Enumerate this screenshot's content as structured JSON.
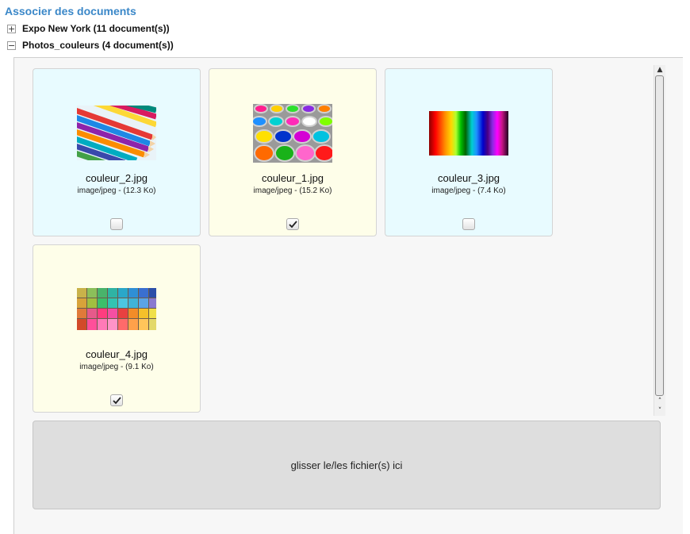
{
  "header": {
    "title": "Associer des documents"
  },
  "groups": [
    {
      "label": "Expo New York (11 document(s))",
      "toggle": "+",
      "expanded": false
    },
    {
      "label": "Photos_couleurs (4 document(s))",
      "toggle": "−",
      "expanded": true
    }
  ],
  "documents": [
    {
      "filename": "couleur_2.jpg",
      "meta": "image/jpeg - (12.3 Ko)",
      "selected": false,
      "thumbnail": "colored-pencils"
    },
    {
      "filename": "couleur_1.jpg",
      "meta": "image/jpeg - (15.2 Ko)",
      "selected": true,
      "thumbnail": "paint-cans"
    },
    {
      "filename": "couleur_3.jpg",
      "meta": "image/jpeg - (7.4 Ko)",
      "selected": false,
      "thumbnail": "rainbow-stripes"
    },
    {
      "filename": "couleur_4.jpg",
      "meta": "image/jpeg - (9.1 Ko)",
      "selected": true,
      "thumbnail": "chalk-pastels"
    }
  ],
  "dropzone": {
    "label": "glisser le/les fichier(s) ici"
  },
  "colors": {
    "title": "#3a87c8",
    "card_unselected": "#e8fbff",
    "card_selected": "#fefee9",
    "dropzone": "#dedede"
  }
}
